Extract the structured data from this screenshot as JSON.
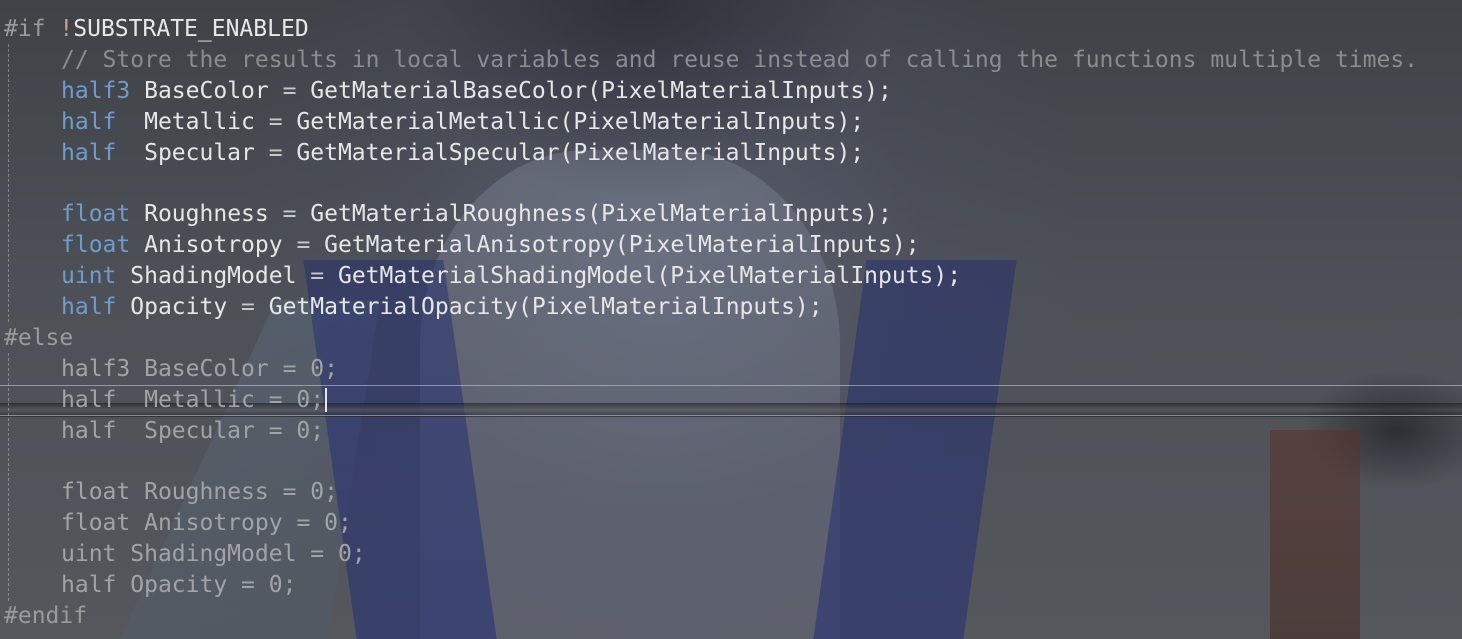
{
  "editor": {
    "if_directive": "#if",
    "if_negation": "!",
    "if_macro": "SUBSTRATE_ENABLED",
    "comment": "// Store the results in local variables and reuse instead of calling the functions multiple times.",
    "active_block": [
      {
        "type": "half3",
        "pad": " ",
        "name": "BaseColor",
        "op": " = ",
        "call": "GetMaterialBaseColor(PixelMaterialInputs);"
      },
      {
        "type": "half",
        "pad": "  ",
        "name": "Metallic",
        "op": " = ",
        "call": "GetMaterialMetallic(PixelMaterialInputs);"
      },
      {
        "type": "half",
        "pad": "  ",
        "name": "Specular",
        "op": " = ",
        "call": "GetMaterialSpecular(PixelMaterialInputs);"
      },
      {
        "type": "float",
        "pad": " ",
        "name": "Roughness",
        "op": " = ",
        "call": "GetMaterialRoughness(PixelMaterialInputs);"
      },
      {
        "type": "float",
        "pad": " ",
        "name": "Anisotropy",
        "op": " = ",
        "call": "GetMaterialAnisotropy(PixelMaterialInputs);"
      },
      {
        "type": "uint",
        "pad": " ",
        "name": "ShadingModel",
        "op": " = ",
        "call": "GetMaterialShadingModel(PixelMaterialInputs);"
      },
      {
        "type": "half",
        "pad": " ",
        "name": "Opacity",
        "op": " = ",
        "call": "GetMaterialOpacity(PixelMaterialInputs);"
      }
    ],
    "else_directive": "#else",
    "inactive_block": [
      {
        "type": "half3",
        "pad": " ",
        "name": "BaseColor",
        "op": " = ",
        "value": "0;"
      },
      {
        "type": "half",
        "pad": "  ",
        "name": "Metallic",
        "op": " = ",
        "value": "0;"
      },
      {
        "type": "half",
        "pad": "  ",
        "name": "Specular",
        "op": " = ",
        "value": "0;"
      },
      {
        "type": "float",
        "pad": " ",
        "name": "Roughness",
        "op": " = ",
        "value": "0;"
      },
      {
        "type": "float",
        "pad": " ",
        "name": "Anisotropy",
        "op": " = ",
        "value": "0;"
      },
      {
        "type": "uint",
        "pad": " ",
        "name": "ShadingModel",
        "op": " = ",
        "value": "0;"
      },
      {
        "type": "half",
        "pad": " ",
        "name": "Opacity",
        "op": " = ",
        "value": "0;"
      }
    ],
    "endif_directive": "#endif",
    "colors": {
      "keyword_type": "#6f9ccc",
      "comment": "#8a8c8f",
      "directive": "#9b9b9b",
      "negation": "#d69d85",
      "text": "#e6e6e6",
      "inactive_text": "#a2a3a6"
    }
  }
}
